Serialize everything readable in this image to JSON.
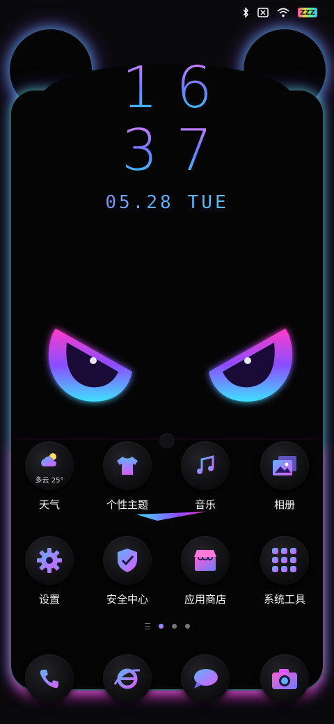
{
  "status_bar": {
    "icons": [
      "bluetooth-icon",
      "sim-error-icon",
      "wifi-icon",
      "battery-icon"
    ],
    "battery_text": "ZZZ"
  },
  "clock": {
    "hour": "16",
    "minute": "37",
    "date": "05.28",
    "weekday": "TUE"
  },
  "apps_row1": [
    {
      "label": "天气",
      "icon": "weather-icon",
      "sub": "多云 25°"
    },
    {
      "label": "个性主题",
      "icon": "tshirt-icon"
    },
    {
      "label": "音乐",
      "icon": "music-note-icon"
    },
    {
      "label": "相册",
      "icon": "gallery-icon"
    }
  ],
  "apps_row2": [
    {
      "label": "设置",
      "icon": "gear-icon"
    },
    {
      "label": "安全中心",
      "icon": "shield-check-icon"
    },
    {
      "label": "应用商店",
      "icon": "store-icon"
    },
    {
      "label": "系统工具",
      "icon": "folder-grid-icon"
    }
  ],
  "dock": [
    {
      "icon": "phone-icon"
    },
    {
      "icon": "browser-icon"
    },
    {
      "icon": "messages-icon"
    },
    {
      "icon": "camera-icon"
    }
  ],
  "pager": {
    "pages": 3,
    "active": 1
  },
  "colors": {
    "accent_cyan": "#3fd6ff",
    "accent_purple": "#b06bff",
    "accent_magenta": "#ff3cc8"
  }
}
